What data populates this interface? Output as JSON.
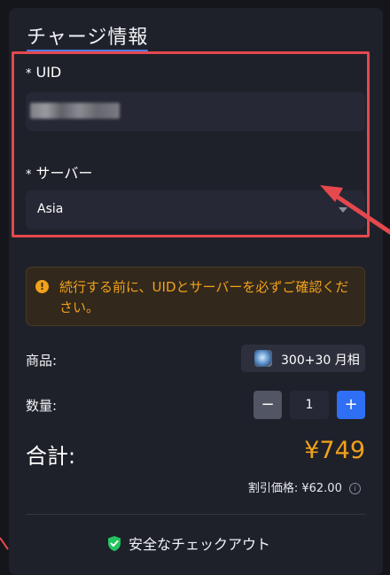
{
  "section": {
    "title": "チャージ情報"
  },
  "form": {
    "uid_required_mark": "*",
    "uid_label": "UID",
    "server_required_mark": "*",
    "server_label": "サーバー",
    "server_selected": "Asia"
  },
  "notice": {
    "text": "続行する前に、UIDとサーバーを必ずご確認ください。"
  },
  "product": {
    "label": "商品:",
    "name": "300+30 月相"
  },
  "quantity": {
    "label": "数量:",
    "minus_label": "−",
    "value": "1",
    "plus_label": "+"
  },
  "total": {
    "label": "合計:",
    "value": "¥749"
  },
  "discount": {
    "label": "割引価格:",
    "value": "¥62.00",
    "info_glyph": "i"
  },
  "checkout": {
    "secure_label": "安全なチェックアウト"
  },
  "colors": {
    "accent_orange": "#f0a21a",
    "accent_blue": "#2f6ff5",
    "highlight_red": "#e5484d",
    "shield_green": "#22c55e"
  },
  "icons": {
    "info": "info-icon",
    "dropdown": "caret-down-icon",
    "secure": "shield-check-icon",
    "annotation": "red-arrow-annotation"
  }
}
